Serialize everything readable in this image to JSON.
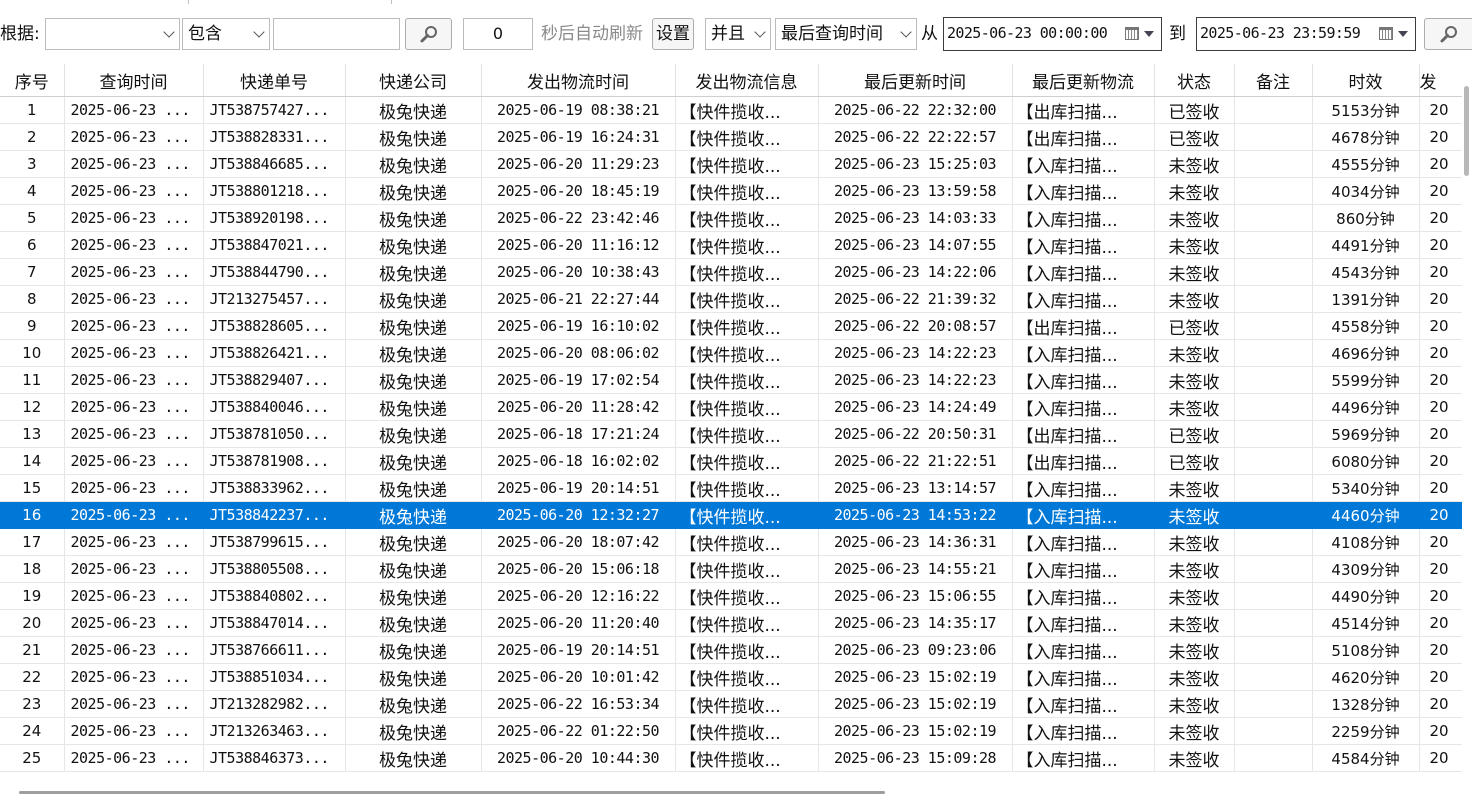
{
  "toolbar": {
    "basis_label": "根据:",
    "basis_value": "",
    "operator_value": "包含",
    "keyword_value": "",
    "refresh_seconds": "0",
    "auto_refresh_label": "秒后自动刷新",
    "settings_button": "设置",
    "logic_value": "并且",
    "time_field_value": "最后查询时间",
    "from_label": "从",
    "from_datetime": "2025-06-23 00:00:00",
    "to_label": "到",
    "to_datetime": "2025-06-23 23:59:59"
  },
  "icons": {
    "search_icon": "search-icon",
    "calendar_icon": "calendar-icon",
    "chevron_icon": "chevron-down-icon"
  },
  "table": {
    "columns": [
      "序号",
      "查询时间",
      "快递单号",
      "快递公司",
      "发出物流时间",
      "发出物流信息",
      "最后更新时间",
      "最后更新物流",
      "状态",
      "备注",
      "时效",
      "发"
    ],
    "selected_index": 15,
    "selection_color": "#0078d7",
    "rows": [
      [
        "1",
        "2025-06-23 ...",
        "JT538757427...",
        "极兔快递",
        "2025-06-19 08:38:21",
        "【快件揽收...",
        "2025-06-22 22:32:00",
        "【出库扫描...",
        "已签收",
        "",
        "5153分钟",
        "20"
      ],
      [
        "2",
        "2025-06-23 ...",
        "JT538828331...",
        "极兔快递",
        "2025-06-19 16:24:31",
        "【快件揽收...",
        "2025-06-22 22:22:57",
        "【出库扫描...",
        "已签收",
        "",
        "4678分钟",
        "20"
      ],
      [
        "3",
        "2025-06-23 ...",
        "JT538846685...",
        "极兔快递",
        "2025-06-20 11:29:23",
        "【快件揽收...",
        "2025-06-23 15:25:03",
        "【入库扫描...",
        "未签收",
        "",
        "4555分钟",
        "20"
      ],
      [
        "4",
        "2025-06-23 ...",
        "JT538801218...",
        "极兔快递",
        "2025-06-20 18:45:19",
        "【快件揽收...",
        "2025-06-23 13:59:58",
        "【入库扫描...",
        "未签收",
        "",
        "4034分钟",
        "20"
      ],
      [
        "5",
        "2025-06-23 ...",
        "JT538920198...",
        "极兔快递",
        "2025-06-22 23:42:46",
        "【快件揽收...",
        "2025-06-23 14:03:33",
        "【入库扫描...",
        "未签收",
        "",
        "860分钟",
        "20"
      ],
      [
        "6",
        "2025-06-23 ...",
        "JT538847021...",
        "极兔快递",
        "2025-06-20 11:16:12",
        "【快件揽收...",
        "2025-06-23 14:07:55",
        "【入库扫描...",
        "未签收",
        "",
        "4491分钟",
        "20"
      ],
      [
        "7",
        "2025-06-23 ...",
        "JT538844790...",
        "极兔快递",
        "2025-06-20 10:38:43",
        "【快件揽收...",
        "2025-06-23 14:22:06",
        "【入库扫描...",
        "未签收",
        "",
        "4543分钟",
        "20"
      ],
      [
        "8",
        "2025-06-23 ...",
        "JT213275457...",
        "极兔快递",
        "2025-06-21 22:27:44",
        "【快件揽收...",
        "2025-06-22 21:39:32",
        "【入库扫描...",
        "未签收",
        "",
        "1391分钟",
        "20"
      ],
      [
        "9",
        "2025-06-23 ...",
        "JT538828605...",
        "极兔快递",
        "2025-06-19 16:10:02",
        "【快件揽收...",
        "2025-06-22 20:08:57",
        "【出库扫描...",
        "已签收",
        "",
        "4558分钟",
        "20"
      ],
      [
        "10",
        "2025-06-23 ...",
        "JT538826421...",
        "极兔快递",
        "2025-06-20 08:06:02",
        "【快件揽收...",
        "2025-06-23 14:22:23",
        "【入库扫描...",
        "未签收",
        "",
        "4696分钟",
        "20"
      ],
      [
        "11",
        "2025-06-23 ...",
        "JT538829407...",
        "极兔快递",
        "2025-06-19 17:02:54",
        "【快件揽收...",
        "2025-06-23 14:22:23",
        "【入库扫描...",
        "未签收",
        "",
        "5599分钟",
        "20"
      ],
      [
        "12",
        "2025-06-23 ...",
        "JT538840046...",
        "极兔快递",
        "2025-06-20 11:28:42",
        "【快件揽收...",
        "2025-06-23 14:24:49",
        "【入库扫描...",
        "未签收",
        "",
        "4496分钟",
        "20"
      ],
      [
        "13",
        "2025-06-23 ...",
        "JT538781050...",
        "极兔快递",
        "2025-06-18 17:21:24",
        "【快件揽收...",
        "2025-06-22 20:50:31",
        "【出库扫描...",
        "已签收",
        "",
        "5969分钟",
        "20"
      ],
      [
        "14",
        "2025-06-23 ...",
        "JT538781908...",
        "极兔快递",
        "2025-06-18 16:02:02",
        "【快件揽收...",
        "2025-06-22 21:22:51",
        "【出库扫描...",
        "已签收",
        "",
        "6080分钟",
        "20"
      ],
      [
        "15",
        "2025-06-23 ...",
        "JT538833962...",
        "极兔快递",
        "2025-06-19 20:14:51",
        "【快件揽收...",
        "2025-06-23 13:14:57",
        "【入库扫描...",
        "未签收",
        "",
        "5340分钟",
        "20"
      ],
      [
        "16",
        "2025-06-23 ...",
        "JT538842237...",
        "极兔快递",
        "2025-06-20 12:32:27",
        "【快件揽收...",
        "2025-06-23 14:53:22",
        "【入库扫描...",
        "未签收",
        "",
        "4460分钟",
        "20"
      ],
      [
        "17",
        "2025-06-23 ...",
        "JT538799615...",
        "极兔快递",
        "2025-06-20 18:07:42",
        "【快件揽收...",
        "2025-06-23 14:36:31",
        "【入库扫描...",
        "未签收",
        "",
        "4108分钟",
        "20"
      ],
      [
        "18",
        "2025-06-23 ...",
        "JT538805508...",
        "极兔快递",
        "2025-06-20 15:06:18",
        "【快件揽收...",
        "2025-06-23 14:55:21",
        "【入库扫描...",
        "未签收",
        "",
        "4309分钟",
        "20"
      ],
      [
        "19",
        "2025-06-23 ...",
        "JT538840802...",
        "极兔快递",
        "2025-06-20 12:16:22",
        "【快件揽收...",
        "2025-06-23 15:06:55",
        "【入库扫描...",
        "未签收",
        "",
        "4490分钟",
        "20"
      ],
      [
        "20",
        "2025-06-23 ...",
        "JT538847014...",
        "极兔快递",
        "2025-06-20 11:20:40",
        "【快件揽收...",
        "2025-06-23 14:35:17",
        "【入库扫描...",
        "未签收",
        "",
        "4514分钟",
        "20"
      ],
      [
        "21",
        "2025-06-23 ...",
        "JT538766611...",
        "极兔快递",
        "2025-06-19 20:14:51",
        "【快件揽收...",
        "2025-06-23 09:23:06",
        "【入库扫描...",
        "未签收",
        "",
        "5108分钟",
        "20"
      ],
      [
        "22",
        "2025-06-23 ...",
        "JT538851034...",
        "极兔快递",
        "2025-06-20 10:01:42",
        "【快件揽收...",
        "2025-06-23 15:02:19",
        "【入库扫描...",
        "未签收",
        "",
        "4620分钟",
        "20"
      ],
      [
        "23",
        "2025-06-23 ...",
        "JT213282982...",
        "极兔快递",
        "2025-06-22 16:53:34",
        "【快件揽收...",
        "2025-06-23 15:02:19",
        "【入库扫描...",
        "未签收",
        "",
        "1328分钟",
        "20"
      ],
      [
        "24",
        "2025-06-23 ...",
        "JT213263463...",
        "极兔快递",
        "2025-06-22 01:22:50",
        "【快件揽收...",
        "2025-06-23 15:02:19",
        "【入库扫描...",
        "未签收",
        "",
        "2259分钟",
        "20"
      ],
      [
        "25",
        "2025-06-23 ...",
        "JT538846373...",
        "极兔快递",
        "2025-06-20 10:44:30",
        "【快件揽收...",
        "2025-06-23 15:09:28",
        "【入库扫描...",
        "未签收",
        "",
        "4584分钟",
        "20"
      ]
    ]
  }
}
